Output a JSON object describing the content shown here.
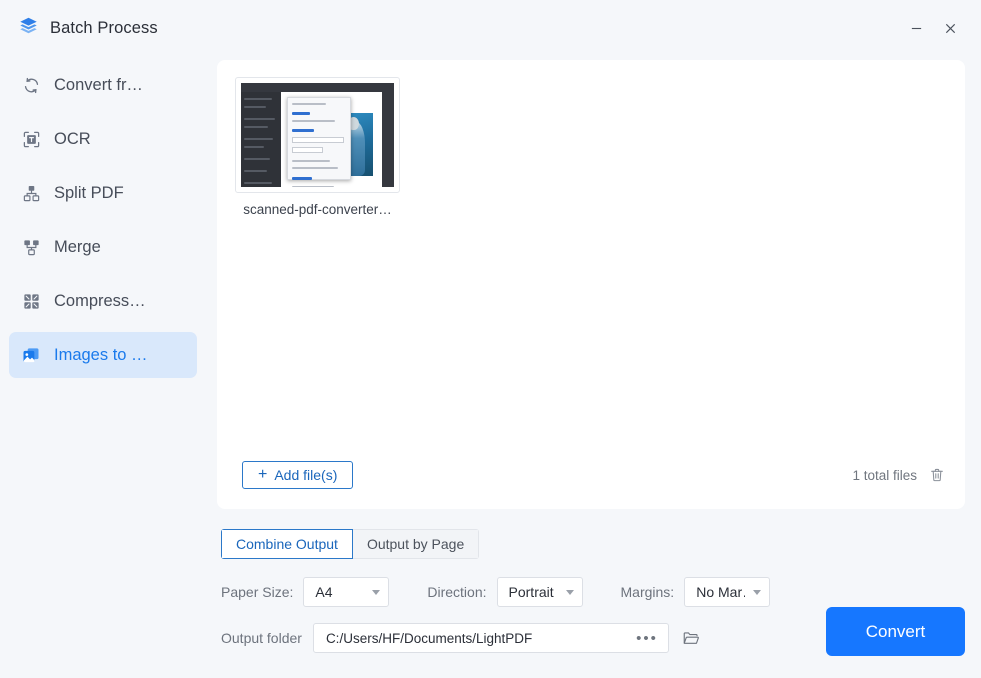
{
  "window": {
    "title": "Batch Process",
    "app_icon": "layers-stack-icon",
    "minimize_label": "−",
    "close_label": "×",
    "accent_color": "#1677ff",
    "active_nav_bg": "#d9e8fb",
    "active_nav_text": "#1a7aec"
  },
  "sidebar": {
    "items": [
      {
        "id": "convert-from",
        "label": "Convert fr…",
        "icon": "convert-refresh-icon",
        "active": false
      },
      {
        "id": "ocr",
        "label": "OCR",
        "icon": "ocr-text-scan-icon",
        "active": false
      },
      {
        "id": "split-pdf",
        "label": "Split PDF",
        "icon": "split-pdf-icon",
        "active": false
      },
      {
        "id": "merge",
        "label": "Merge",
        "icon": "merge-icon",
        "active": false
      },
      {
        "id": "compress",
        "label": "Compress…",
        "icon": "compress-grid-icon",
        "active": false
      },
      {
        "id": "images-to-pdf",
        "label": "Images to …",
        "icon": "image-to-pdf-icon",
        "active": true
      }
    ]
  },
  "files": {
    "items": [
      {
        "name": "scanned-pdf-converter…",
        "thumbnail": "pdf-app-screenshot-thumbnail"
      }
    ],
    "add_button_label": "Add file(s)",
    "add_button_plus": "+",
    "total_label": "1 total files",
    "delete_icon": "trash-icon"
  },
  "output_mode": {
    "options": [
      {
        "id": "combine-output",
        "label": "Combine Output",
        "selected": true
      },
      {
        "id": "output-by-page",
        "label": "Output by Page",
        "selected": false
      }
    ]
  },
  "settings": {
    "paper_size": {
      "label": "Paper Size:",
      "value": "A4"
    },
    "direction": {
      "label": "Direction:",
      "value": "Portrait"
    },
    "margins": {
      "label": "Margins:",
      "value": "No Mar…"
    },
    "output_folder": {
      "label": "Output folder",
      "value": "C:/Users/HF/Documents/LightPDF",
      "browse_dots": "•••",
      "folder_icon": "open-folder-icon"
    }
  },
  "actions": {
    "convert_label": "Convert"
  }
}
